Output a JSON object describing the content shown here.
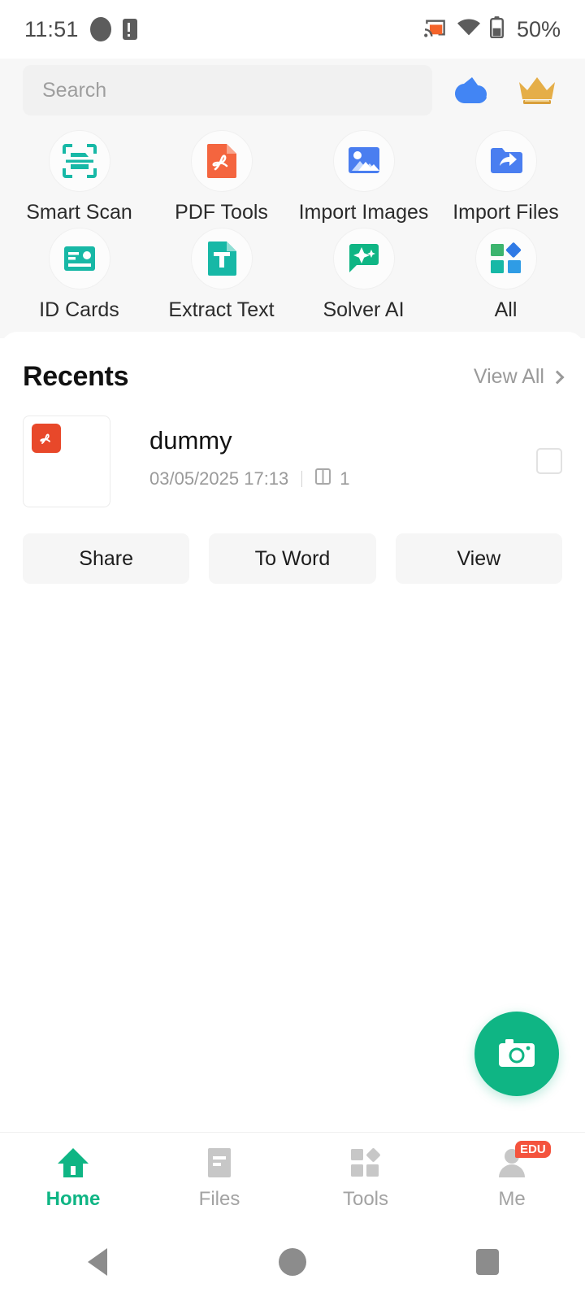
{
  "status_bar": {
    "time": "11:51",
    "battery_percent": "50%",
    "icons": [
      "notification-blob-icon",
      "sim-alert-icon",
      "screen-cast-icon",
      "wifi-icon",
      "battery-icon"
    ],
    "cast_color": "#f4632a"
  },
  "search": {
    "placeholder": "Search",
    "value": "",
    "cloud_icon": "cloud-icon",
    "crown_icon": "crown-icon",
    "cloud_color": "#4285f4",
    "crown_color": "#e5ae48"
  },
  "shortcuts": [
    {
      "label": "Smart Scan",
      "icon": "smart-scan-icon",
      "color": "#17b8a6"
    },
    {
      "label": "PDF Tools",
      "icon": "pdf-tools-icon",
      "color": "#f4653f"
    },
    {
      "label": "Import Images",
      "icon": "import-images-icon",
      "color": "#4a7ef0"
    },
    {
      "label": "Import Files",
      "icon": "import-files-icon",
      "color": "#4a7ef0"
    },
    {
      "label": "ID Cards",
      "icon": "id-cards-icon",
      "color": "#17b8a6"
    },
    {
      "label": "Extract Text",
      "icon": "extract-text-icon",
      "color": "#17b8a6"
    },
    {
      "label": "Solver AI",
      "icon": "solver-ai-icon",
      "color": "#0fb584"
    },
    {
      "label": "All",
      "icon": "all-tools-icon",
      "color": "#2f9e6e"
    }
  ],
  "recents": {
    "title": "Recents",
    "view_all_label": "View All",
    "files": [
      {
        "name": "dummy",
        "date": "03/05/2025 17:13",
        "page_count": "1",
        "type_badge": "pdf",
        "selected": false
      }
    ]
  },
  "actions": [
    {
      "label": "Share"
    },
    {
      "label": "To Word"
    },
    {
      "label": "View"
    }
  ],
  "fab": {
    "icon": "camera-icon",
    "color": "#0fb584"
  },
  "bottom_nav": {
    "active": "Home",
    "items": [
      {
        "label": "Home",
        "icon": "home-icon",
        "active": true,
        "badge": ""
      },
      {
        "label": "Files",
        "icon": "files-icon",
        "active": false,
        "badge": ""
      },
      {
        "label": "Tools",
        "icon": "tools-icon",
        "active": false,
        "badge": ""
      },
      {
        "label": "Me",
        "icon": "profile-icon",
        "active": false,
        "badge": "EDU"
      }
    ]
  },
  "system_nav": {
    "back": "back-button",
    "home": "home-button",
    "recents": "recents-button"
  }
}
